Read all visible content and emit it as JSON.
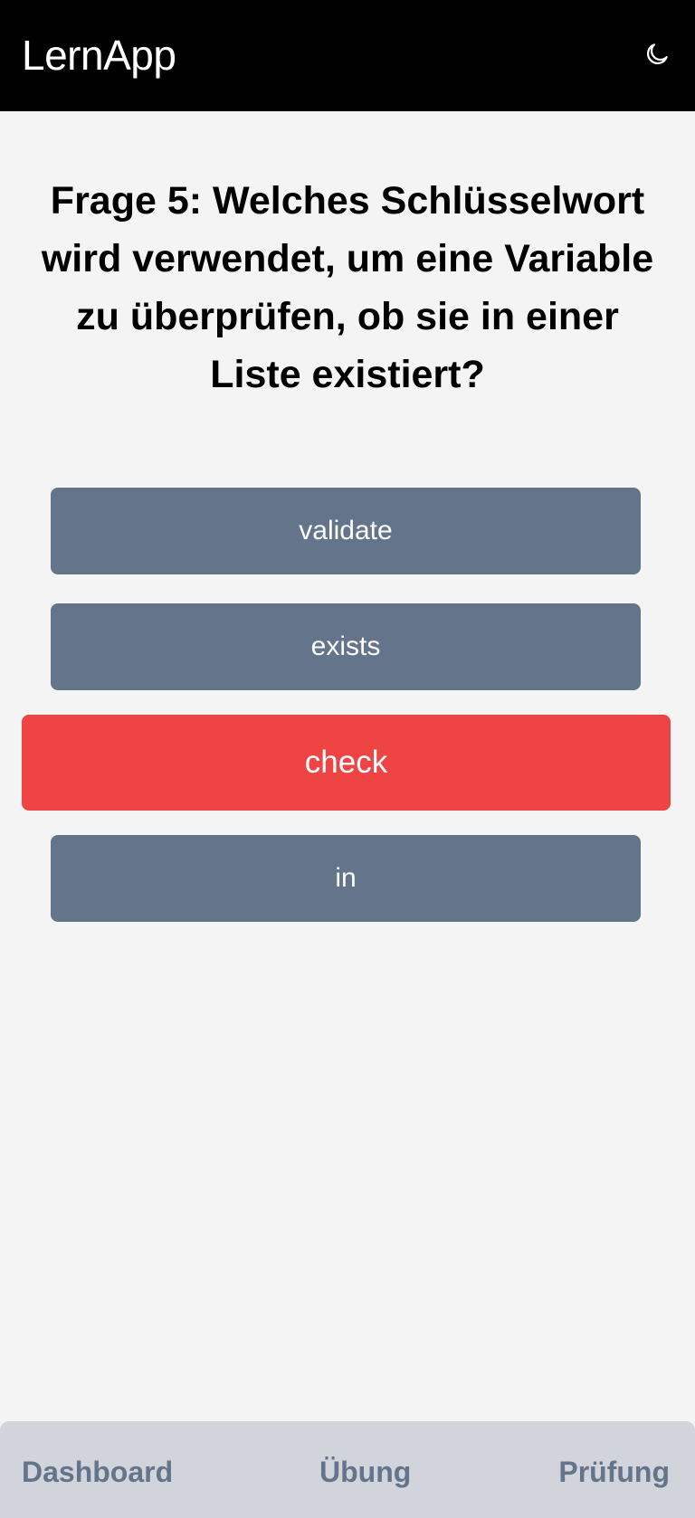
{
  "header": {
    "title": "LernApp",
    "theme_icon": "moon-icon"
  },
  "quiz": {
    "question": "Frage 5: Welches Schlüsselwort wird verwendet, um eine Variable zu überprüfen, ob sie in einer Liste existiert?",
    "answers": [
      {
        "label": "validate",
        "state": "default"
      },
      {
        "label": "exists",
        "state": "default"
      },
      {
        "label": "check",
        "state": "selected-wrong"
      },
      {
        "label": "in",
        "state": "default"
      }
    ]
  },
  "bottom_nav": {
    "items": [
      {
        "label": "Dashboard"
      },
      {
        "label": "Übung"
      },
      {
        "label": "Prüfung"
      }
    ]
  },
  "colors": {
    "header_bg": "#000000",
    "page_bg": "#f4f4f5",
    "answer_default": "#64748b",
    "answer_wrong": "#ef4444",
    "nav_bg": "#d1d5db",
    "nav_text": "#64748b"
  }
}
